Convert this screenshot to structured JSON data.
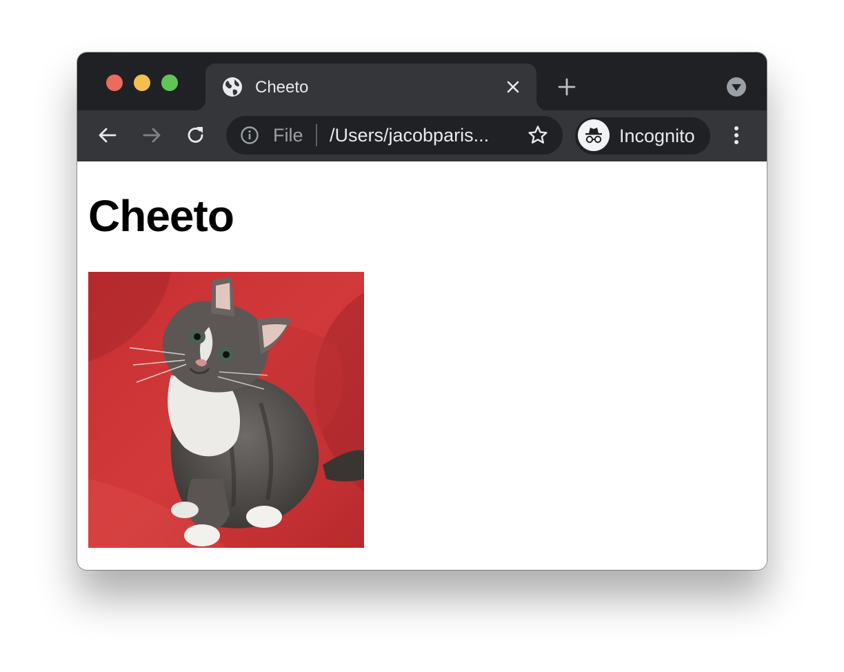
{
  "browser": {
    "tab": {
      "title": "Cheeto",
      "favicon": "globe-icon"
    },
    "toolbar": {
      "scheme": "File",
      "url": "/Users/jacobparis...",
      "profile_label": "Incognito"
    }
  },
  "page": {
    "heading": "Cheeto",
    "image": {
      "subject": "kitten-photo"
    }
  },
  "colors": {
    "tabstrip": "#202124",
    "toolbar": "#35363a",
    "omnibox": "#202124",
    "close": "#ed6a5e",
    "minimize": "#f5bf4f",
    "maximize": "#61c554"
  }
}
